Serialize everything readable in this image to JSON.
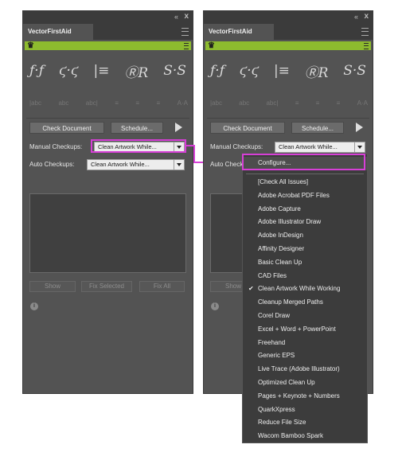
{
  "panel": {
    "title": "VectorFirstAid",
    "collapse_glyph": "«",
    "close_glyph": "x",
    "crown_glyph": "♛",
    "style_icons": [
      "ƒ·ƒ",
      "ϛ·ϛ",
      "|≡",
      "ⓇR",
      "S·S"
    ],
    "text_icons": [
      "|abc",
      "abc",
      "abc|",
      "≡",
      "≡",
      "≡",
      "A·A"
    ],
    "check_document_label": "Check Document",
    "schedule_label": "Schedule...",
    "manual_label": "Manual Checkups:",
    "manual_value": "Clean Artwork While...",
    "auto_label": "Auto Checkups:",
    "auto_value": "Clean Artwork While...",
    "show_label": "Show",
    "fix_selected_label": "Fix Selected",
    "fix_all_label": "Fix All",
    "info_glyph": "i"
  },
  "dropdown": {
    "items": [
      "Configure...",
      "[Check All Issues]",
      "Adobe Acrobat PDF Files",
      "Adobe Capture",
      "Adobe Illustrator Draw",
      "Adobe InDesign",
      "Affinity Designer",
      "Basic Clean Up",
      "CAD Files",
      "Clean Artwork While Working",
      "Cleanup Merged Paths",
      "Corel Draw",
      "Excel + Word + PowerPoint",
      "Freehand",
      "Generic EPS",
      "Live Trace (Adobe Illustrator)",
      "Optimized Clean Up",
      "Pages + Keynote + Numbers",
      "QuarkXpress",
      "Reduce File Size",
      "Wacom Bamboo Spark"
    ],
    "checked_item": "Clean Artwork While Working",
    "check_glyph": "✔"
  },
  "colors": {
    "panel_bg": "#535353",
    "accent_green": "#8dbb2e",
    "highlight": "#d63fd6"
  },
  "icons": [
    "collapse-icon",
    "close-icon",
    "panel-menu-icon",
    "crown-logo-icon",
    "play-icon",
    "dropdown-arrow-icon",
    "info-icon",
    "checkmark-icon"
  ]
}
